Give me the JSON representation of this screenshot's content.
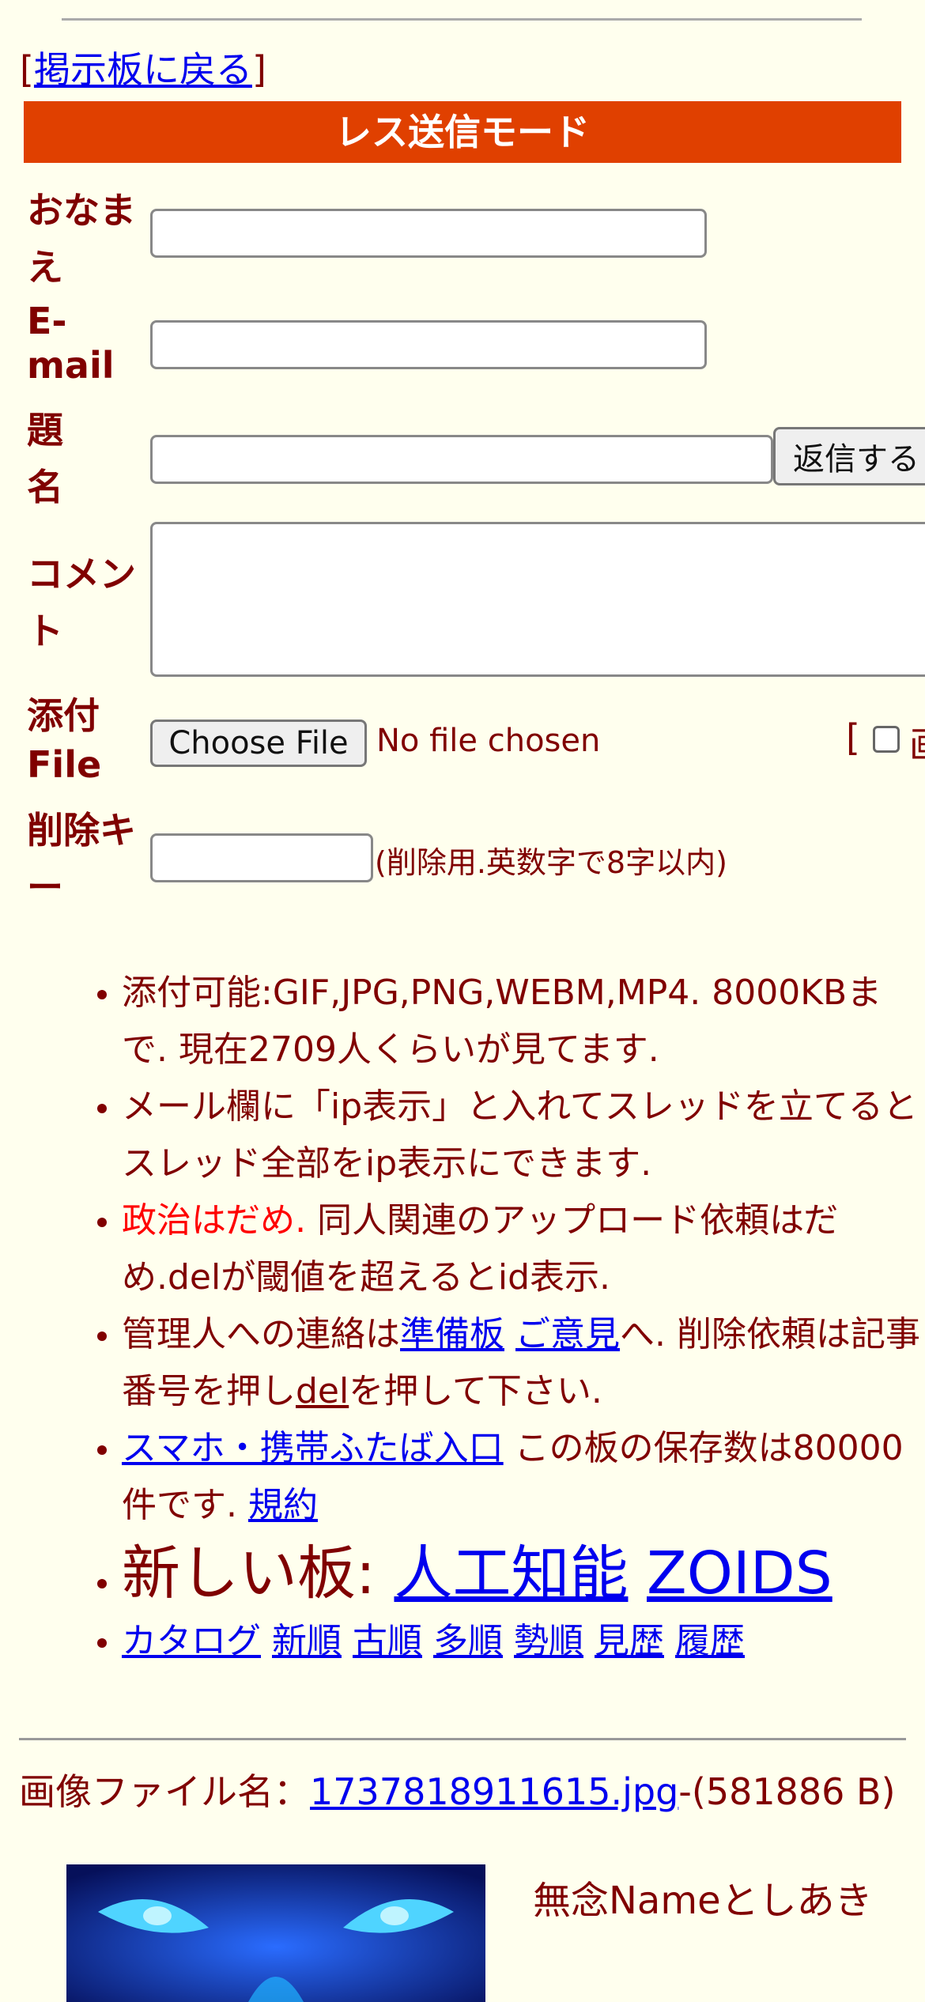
{
  "nav": {
    "back_link": "掲示板に戻る"
  },
  "banner": "レス送信モード",
  "form": {
    "name_label": "おなまえ",
    "email_label": "E-mail",
    "subject_label": "題名",
    "submit_label": "返信する",
    "comment_label": "コメント",
    "file_label": "添付File",
    "choose_file_label": "Choose File",
    "no_file_text": "No file chosen",
    "delkey_label": "削除キー",
    "delkey_hint": "(削除用.英数字で8字以内)"
  },
  "rules": {
    "r1": "添付可能:GIF,JPG,PNG,WEBM,MP4. 8000KBまで. 現在2709人くらいが見てます.",
    "r2": "メール欄に「ip表示」と入れてスレッドを立てるとスレッド全部をip表示にできます.",
    "r3_red": "政治はだめ.",
    "r3_rest": " 同人関連のアップロード依頼はだめ.delが閾値を超えるとid表示.",
    "r4_a": "管理人への連絡は",
    "r4_link1": "準備板",
    "r4_link2": "ご意見",
    "r4_b": "へ. 削除依頼は記事番号を押し",
    "r4_del": "del",
    "r4_c": "を押して下さい.",
    "r5_link": "スマホ・携帯ふたば入口",
    "r5_text": " この板の保存数は80000件です. ",
    "r5_terms": "規約",
    "r6_label": "新しい板: ",
    "r6_link1": "人工知能",
    "r6_link2": "ZOIDS",
    "sort_links": [
      "カタログ",
      "新順",
      "古順",
      "多順",
      "勢順",
      "見歴",
      "履歴"
    ]
  },
  "post": {
    "file_prefix": "画像ファイル名：",
    "file_name": "1737818911615.jpg",
    "file_size": "-(581886 B)",
    "name_text": "無念Nameとしあき"
  }
}
